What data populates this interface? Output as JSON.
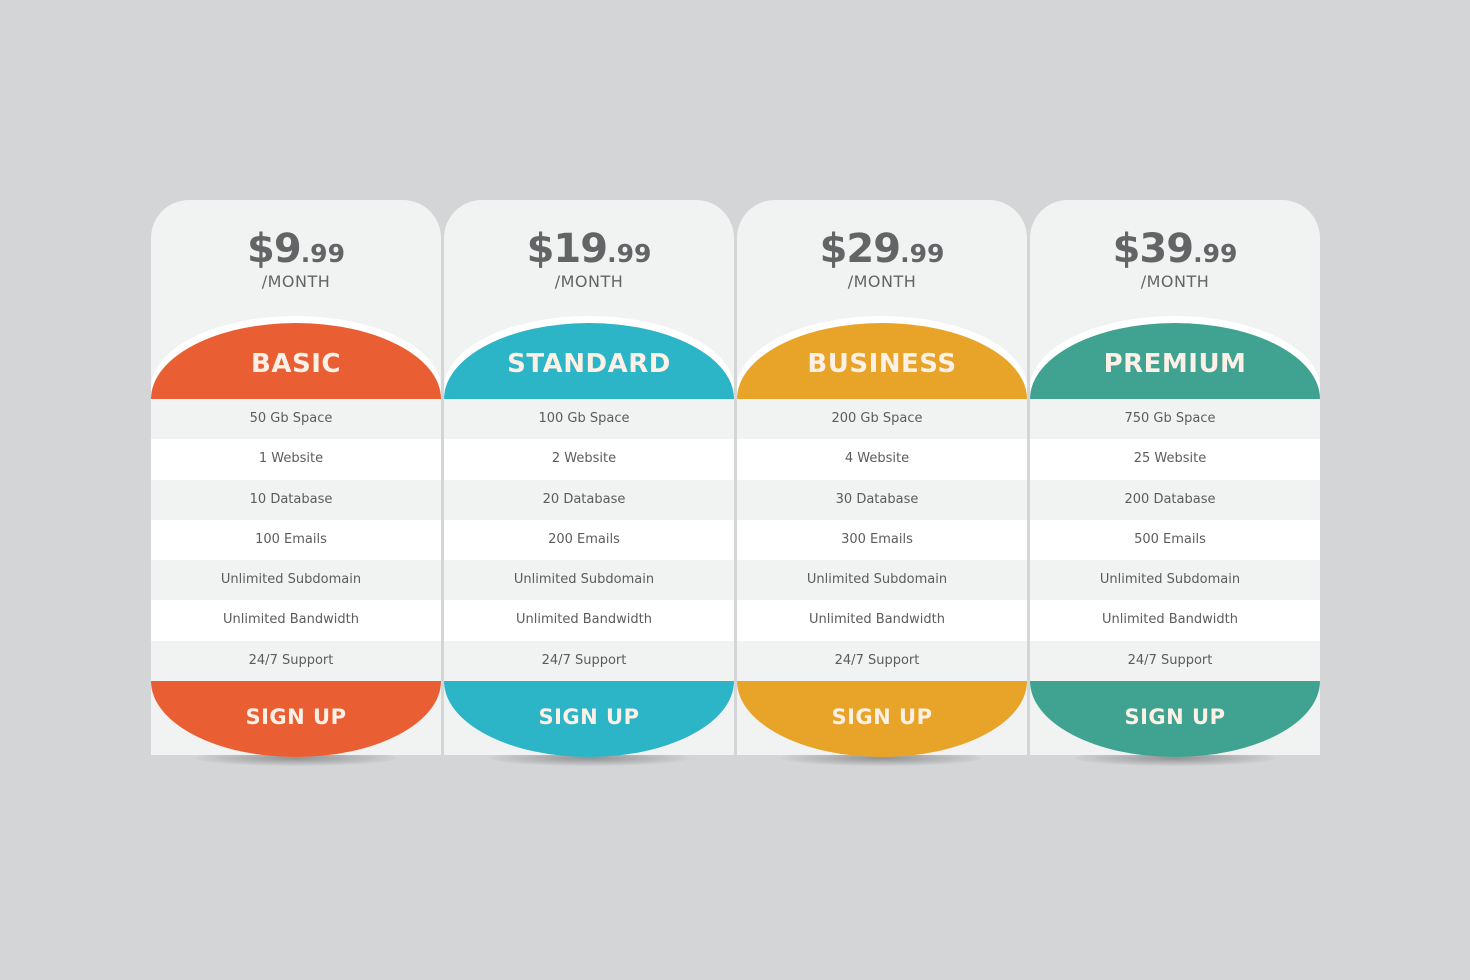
{
  "plans": [
    {
      "name": "BASIC",
      "price_main": "$9",
      "price_cents": ".99",
      "period": "/MONTH",
      "color": "#e95f33",
      "features": [
        "50 Gb Space",
        "1 Website",
        "10 Database",
        "100 Emails",
        "Unlimited Subdomain",
        "Unlimited Bandwidth",
        "24/7 Support"
      ],
      "cta": "SIGN UP"
    },
    {
      "name": "STANDARD",
      "price_main": "$19",
      "price_cents": ".99",
      "period": "/MONTH",
      "color": "#2cb4c7",
      "features": [
        "100 Gb Space",
        "2 Website",
        "20 Database",
        "200 Emails",
        "Unlimited Subdomain",
        "Unlimited Bandwidth",
        "24/7 Support"
      ],
      "cta": "SIGN UP"
    },
    {
      "name": "BUSINESS",
      "price_main": "$29",
      "price_cents": ".99",
      "period": "/MONTH",
      "color": "#e8a428",
      "features": [
        "200 Gb Space",
        "4 Website",
        "30 Database",
        "300 Emails",
        "Unlimited Subdomain",
        "Unlimited Bandwidth",
        "24/7 Support"
      ],
      "cta": "SIGN UP"
    },
    {
      "name": "PREMIUM",
      "price_main": "$39",
      "price_cents": ".99",
      "period": "/MONTH",
      "color": "#40a391",
      "features": [
        "750 Gb Space",
        "25 Website",
        "200 Database",
        "500 Emails",
        "Unlimited Subdomain",
        "Unlimited Bandwidth",
        "24/7 Support"
      ],
      "cta": "SIGN UP"
    }
  ]
}
